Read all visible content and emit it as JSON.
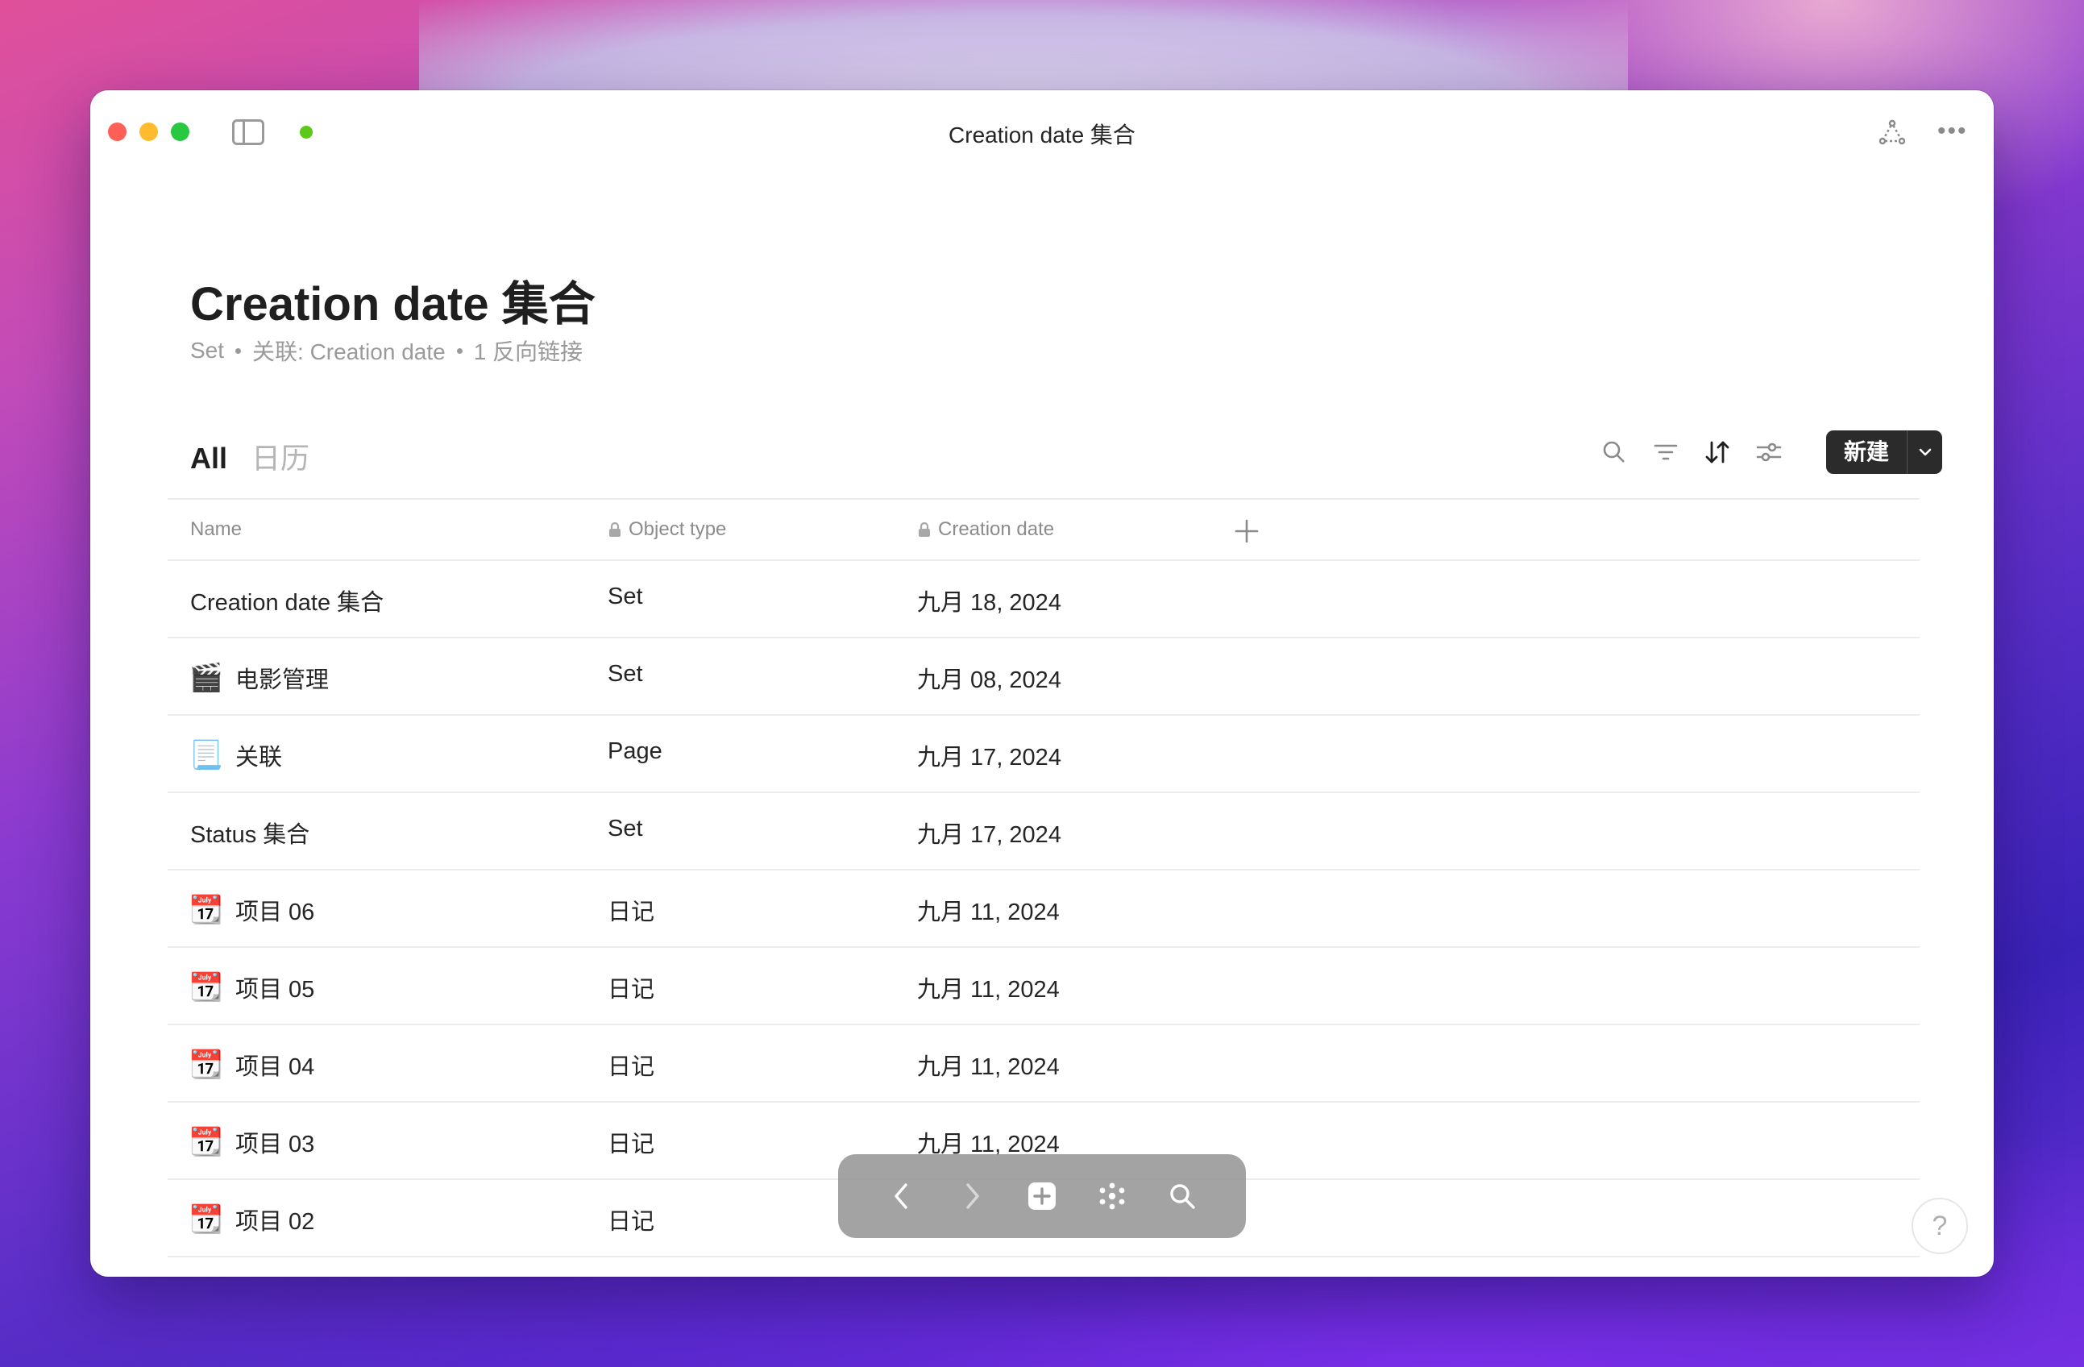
{
  "window": {
    "title": "Creation date 集合"
  },
  "page": {
    "title": "Creation date 集合",
    "meta": {
      "type": "Set",
      "relation": "关联: Creation date",
      "backlinks": "1 反向链接"
    }
  },
  "views": {
    "tabs": [
      {
        "label": "All",
        "active": true
      },
      {
        "label": "日历",
        "active": false
      }
    ]
  },
  "toolbar": {
    "new_label": "新建"
  },
  "table": {
    "columns": {
      "name": "Name",
      "type": "Object type",
      "date": "Creation date"
    },
    "rows": [
      {
        "icon": "none",
        "name": "Creation date 集合",
        "type": "Set",
        "date": "九月 18, 2024"
      },
      {
        "icon": "clapper-board-icon",
        "emoji": "🎬",
        "name": "电影管理",
        "type": "Set",
        "date": "九月 08, 2024"
      },
      {
        "icon": "page-icon",
        "emoji": "📃",
        "name": "关联",
        "type": "Page",
        "date": "九月 17, 2024"
      },
      {
        "icon": "none",
        "name": "Status 集合",
        "type": "Set",
        "date": "九月 17, 2024"
      },
      {
        "icon": "calendar-note-icon",
        "emoji": "📆",
        "name": "项目 06",
        "type": "日记",
        "date": "九月 11, 2024"
      },
      {
        "icon": "calendar-note-icon",
        "emoji": "📆",
        "name": "项目 05",
        "type": "日记",
        "date": "九月 11, 2024"
      },
      {
        "icon": "calendar-note-icon",
        "emoji": "📆",
        "name": "项目 04",
        "type": "日记",
        "date": "九月 11, 2024"
      },
      {
        "icon": "calendar-note-icon",
        "emoji": "📆",
        "name": "项目 03",
        "type": "日记",
        "date": "九月 11, 2024"
      },
      {
        "icon": "calendar-note-icon",
        "emoji": "📆",
        "name": "项目 02",
        "type": "日记",
        "date": ""
      }
    ]
  },
  "help": {
    "label": "?"
  },
  "colors": {
    "primary_button": "#2b2b2b",
    "status_dot": "#5bc81a",
    "divider": "#ececec"
  }
}
